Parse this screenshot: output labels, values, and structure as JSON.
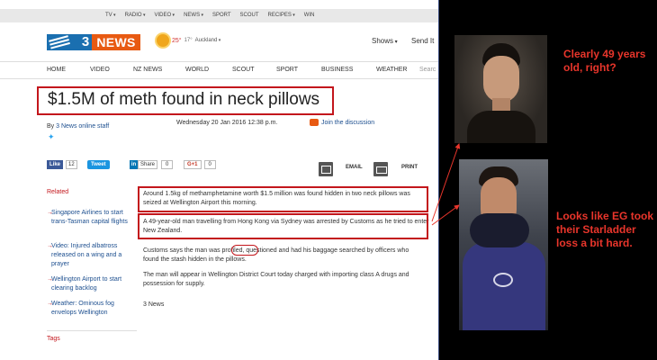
{
  "topbar": {
    "items": [
      {
        "label": "TV",
        "caret": true
      },
      {
        "label": "RADIO",
        "caret": true
      },
      {
        "label": "VIDEO",
        "caret": true
      },
      {
        "label": "NEWS",
        "caret": true
      },
      {
        "label": "SPORT",
        "caret": false
      },
      {
        "label": "SCOUT",
        "caret": false
      },
      {
        "label": "RECIPES",
        "caret": true
      },
      {
        "label": "WIN",
        "caret": false
      }
    ]
  },
  "header": {
    "logo_number": "3",
    "logo_word": "NEWS",
    "weather": {
      "high": "25°",
      "low": "17°",
      "city": "Auckland",
      "icon": "sun-icon"
    },
    "shows_label": "Shows",
    "send_it_label": "Send It"
  },
  "nav": {
    "items": [
      "HOME",
      "VIDEO",
      "NZ NEWS",
      "WORLD",
      "SCOUT",
      "SPORT",
      "BUSINESS",
      "WEATHER"
    ],
    "search_placeholder": "Searc"
  },
  "article": {
    "headline": "$1.5M of meth found in neck pillows",
    "byline_prefix": "By",
    "byline_author": "3 News online staff",
    "date": "Wednesday 20 Jan 2016 12:38 p.m.",
    "discussion_link": "Join the discussion",
    "paragraphs": [
      "Around 1.5kg of methamphetamine worth $1.5 million was found hidden in two neck pillows was seized at Wellington Airport this morning.",
      "A 49-year-old man travelling from Hong Kong via Sydney was arrested by Customs as he tried to enter New Zealand.",
      "Customs says the man was profiled, questioned and had his baggage searched by officers who found the stash hidden in the pillows.",
      "The man will appear in Wellington District Court today charged with importing class A drugs and possession for supply."
    ],
    "credit": "3 News"
  },
  "share": {
    "fb_like": "Like",
    "fb_count": "12",
    "tweet": "Tweet",
    "linkedin": "Share",
    "linkedin_count": "0",
    "gplus": "G+1",
    "gplus_count": "0",
    "email": "EMAIL",
    "print": "PRINT"
  },
  "sidebar": {
    "related_title": "Related",
    "related": [
      "Singapore Airlines to start trans-Tasman capital flights",
      "Video: Injured albatross released on a wing and a prayer",
      "Wellington Airport to start clearing backlog",
      "Weather: Ominous fog envelops Wellington"
    ],
    "tags_title": "Tags"
  },
  "annotations": {
    "caption_top": "Clearly 49 years old, right?",
    "caption_bottom": "Looks like EG took their Starladder loss a bit hard.",
    "accent_color": "#e8352b"
  }
}
